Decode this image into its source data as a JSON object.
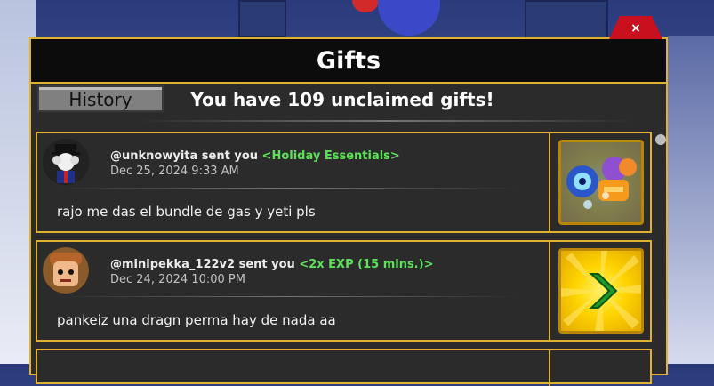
{
  "window": {
    "title": "Gifts",
    "close_label": "×"
  },
  "toolbar": {
    "history_label": "History",
    "unclaimed_text": "You have 109 unclaimed gifts!"
  },
  "gifts": [
    {
      "sender": "@unknowyita sent you",
      "item": "<Holiday Essentials>",
      "date": "Dec 25, 2024 9:33 AM",
      "message": "rajo me das el bundle de gas y yeti pls",
      "claim_icon": "fruits-bundle-icon"
    },
    {
      "sender": "@minipekka_122v2 sent you",
      "item": "<2x EXP (15 mins.)>",
      "date": "Dec 24, 2024 10:00 PM",
      "message": "pankeiz una dragn perma hay de nada aa",
      "claim_icon": "green-arrow-icon"
    }
  ],
  "colors": {
    "panel_border": "#e0b22f",
    "item_name": "#5ee05a",
    "close_button": "#c8101f",
    "claim_button": "#ffd400"
  }
}
